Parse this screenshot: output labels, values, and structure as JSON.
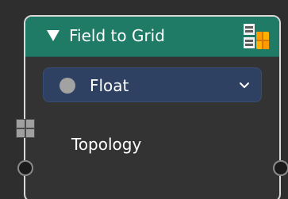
{
  "node": {
    "title": "Field to Grid",
    "data_type": {
      "selected": "Float"
    },
    "inputs": [
      {
        "label": "Topology"
      }
    ]
  },
  "colors": {
    "header": "#1f7a66",
    "body": "#333333",
    "border": "#d8d8d8",
    "dropdown": "#2f4163",
    "float_socket": "#a2a2a2",
    "type_icon_accent": "#ffb000"
  },
  "icons": {
    "collapse": "triangle-down-icon",
    "type": "grid-node-type-icon",
    "data_type": "float-dot-icon",
    "dropdown": "chevron-down-icon",
    "topology_socket": "grid-square-socket-icon"
  }
}
